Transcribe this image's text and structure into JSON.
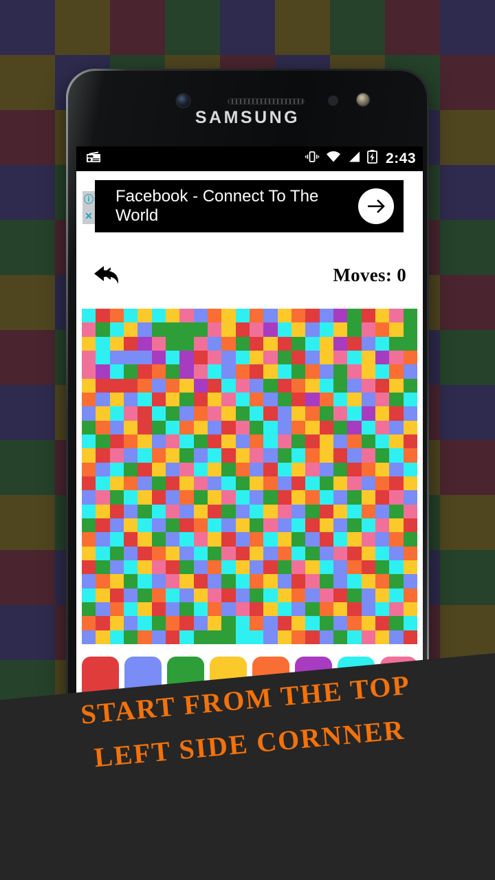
{
  "background": {
    "block_size": 80,
    "colors": [
      "#2e2b4e",
      "#4f4620",
      "#26422a",
      "#4a2530",
      "#2e2b4e",
      "#4f4620",
      "#26422a",
      "#4a2530"
    ],
    "grid": [
      [
        0,
        1,
        3,
        2,
        0,
        1,
        2,
        3,
        0
      ],
      [
        1,
        0,
        2,
        1,
        3,
        0,
        1,
        2,
        3
      ],
      [
        3,
        1,
        0,
        2,
        1,
        3,
        2,
        0,
        1
      ],
      [
        0,
        2,
        1,
        3,
        0,
        1,
        3,
        2,
        0
      ],
      [
        2,
        3,
        0,
        1,
        2,
        0,
        1,
        3,
        2
      ],
      [
        1,
        0,
        3,
        2,
        1,
        3,
        0,
        1,
        3
      ],
      [
        3,
        2,
        1,
        0,
        3,
        2,
        1,
        0,
        2
      ],
      [
        0,
        1,
        2,
        3,
        0,
        1,
        2,
        3,
        0
      ],
      [
        2,
        3,
        1,
        0,
        2,
        3,
        0,
        1,
        3
      ],
      [
        1,
        2,
        0,
        3,
        1,
        0,
        3,
        2,
        1
      ],
      [
        3,
        0,
        2,
        1,
        3,
        2,
        1,
        0,
        2
      ],
      [
        0,
        3,
        1,
        2,
        0,
        1,
        2,
        3,
        1
      ],
      [
        2,
        1,
        3,
        0,
        2,
        3,
        0,
        1,
        0
      ],
      [
        1,
        3,
        0,
        2,
        1,
        0,
        3,
        2,
        3
      ],
      [
        3,
        2,
        1,
        3,
        0,
        2,
        1,
        0,
        1
      ],
      [
        0,
        1,
        2,
        0,
        3,
        1,
        2,
        3,
        2
      ]
    ]
  },
  "phone": {
    "brand": "SAMSUNG",
    "camera_icon": "front-camera-icon",
    "speaker_icon": "earpiece-speaker-icon",
    "sensor_icon": "proximity-sensor-icon",
    "flash_icon": "iris-sensor-icon"
  },
  "statusbar": {
    "notification_icon": "radio-news-icon",
    "vibrate_icon": "vibrate-icon",
    "wifi_icon": "wifi-icon",
    "signal_icon": "cellular-signal-icon",
    "battery_icon": "battery-charging-icon",
    "time": "2:43"
  },
  "ad": {
    "headline": "Facebook - Connect To The World",
    "cta_icon": "arrow-right-icon",
    "adchoices_info_icon": "info-icon",
    "adchoices_close_icon": "close-icon"
  },
  "toolbar": {
    "undo_icon": "undo-arrow-icon",
    "moves_label": "Moves: 0"
  },
  "game": {
    "grid_size": 24,
    "palette_colors": [
      "#e03c3c",
      "#7a8cf5",
      "#2e9e38",
      "#fcc92a",
      "#f96e32",
      "#a83cc0",
      "#2ef0f0",
      "#f07099"
    ],
    "cell_colors": [
      "#2ef0f0",
      "#e03c3c",
      "#f96e32",
      "#f07099",
      "#2e9e38",
      "#fcc92a",
      "#7a8cf5",
      "#a83cc0"
    ],
    "cells": [
      [
        0,
        1,
        2,
        0,
        5,
        0,
        5,
        3,
        6,
        2,
        5,
        0,
        2,
        6,
        5,
        2,
        1,
        6,
        7,
        4,
        1,
        5,
        3,
        4
      ],
      [
        3,
        4,
        0,
        5,
        6,
        4,
        4,
        4,
        4,
        3,
        5,
        1,
        3,
        7,
        0,
        5,
        6,
        0,
        5,
        4,
        3,
        2,
        5,
        4
      ],
      [
        5,
        0,
        5,
        1,
        7,
        3,
        4,
        4,
        3,
        6,
        2,
        4,
        1,
        5,
        1,
        4,
        0,
        5,
        7,
        1,
        6,
        0,
        4,
        4
      ],
      [
        3,
        0,
        6,
        6,
        6,
        7,
        0,
        7,
        1,
        3,
        6,
        0,
        5,
        3,
        4,
        1,
        6,
        5,
        3,
        0,
        5,
        7,
        3,
        2
      ],
      [
        3,
        7,
        0,
        4,
        1,
        2,
        4,
        7,
        3,
        0,
        6,
        2,
        1,
        5,
        0,
        4,
        2,
        6,
        4,
        3,
        5,
        0,
        2,
        6
      ],
      [
        5,
        1,
        1,
        1,
        2,
        6,
        2,
        5,
        7,
        1,
        0,
        3,
        6,
        4,
        1,
        2,
        5,
        0,
        4,
        6,
        3,
        1,
        5,
        4
      ],
      [
        2,
        6,
        5,
        6,
        0,
        1,
        5,
        4,
        1,
        5,
        3,
        0,
        2,
        6,
        4,
        1,
        7,
        2,
        0,
        5,
        6,
        3,
        4,
        0
      ],
      [
        6,
        5,
        0,
        3,
        1,
        0,
        4,
        6,
        2,
        3,
        5,
        4,
        0,
        1,
        6,
        5,
        2,
        4,
        3,
        0,
        7,
        5,
        1,
        6
      ],
      [
        4,
        2,
        6,
        5,
        1,
        4,
        0,
        2,
        5,
        6,
        1,
        3,
        4,
        0,
        6,
        2,
        5,
        1,
        4,
        7,
        0,
        3,
        6,
        5
      ],
      [
        0,
        4,
        1,
        2,
        5,
        6,
        3,
        0,
        4,
        1,
        5,
        6,
        2,
        0,
        3,
        4,
        1,
        5,
        6,
        2,
        4,
        0,
        5,
        1
      ],
      [
        5,
        1,
        3,
        6,
        0,
        2,
        5,
        4,
        6,
        0,
        1,
        5,
        3,
        6,
        4,
        0,
        2,
        5,
        1,
        6,
        3,
        4,
        0,
        2
      ],
      [
        2,
        6,
        0,
        4,
        1,
        5,
        6,
        3,
        0,
        5,
        4,
        2,
        6,
        1,
        0,
        5,
        3,
        6,
        4,
        1,
        2,
        5,
        6,
        0
      ],
      [
        1,
        0,
        5,
        2,
        6,
        4,
        1,
        5,
        3,
        6,
        0,
        4,
        5,
        2,
        6,
        1,
        0,
        4,
        5,
        3,
        6,
        2,
        1,
        5
      ],
      [
        6,
        3,
        4,
        0,
        5,
        1,
        6,
        2,
        4,
        5,
        3,
        0,
        6,
        4,
        1,
        5,
        2,
        0,
        6,
        4,
        5,
        1,
        3,
        6
      ],
      [
        0,
        5,
        1,
        6,
        4,
        0,
        3,
        6,
        5,
        1,
        4,
        6,
        0,
        5,
        3,
        6,
        4,
        1,
        5,
        0,
        2,
        6,
        4,
        3
      ],
      [
        4,
        1,
        6,
        5,
        0,
        6,
        4,
        1,
        2,
        0,
        6,
        5,
        4,
        3,
        6,
        0,
        1,
        5,
        6,
        4,
        0,
        3,
        5,
        1
      ],
      [
        2,
        6,
        0,
        1,
        5,
        4,
        6,
        0,
        3,
        5,
        1,
        6,
        2,
        0,
        5,
        4,
        6,
        1,
        0,
        5,
        3,
        6,
        2,
        4
      ],
      [
        5,
        0,
        4,
        6,
        1,
        2,
        5,
        6,
        0,
        4,
        3,
        1,
        5,
        6,
        2,
        0,
        4,
        6,
        3,
        1,
        5,
        0,
        6,
        2
      ],
      [
        1,
        4,
        6,
        0,
        5,
        3,
        1,
        4,
        6,
        2,
        0,
        5,
        6,
        1,
        4,
        3,
        5,
        0,
        6,
        2,
        1,
        4,
        0,
        5
      ],
      [
        6,
        2,
        5,
        4,
        0,
        6,
        3,
        5,
        1,
        6,
        4,
        0,
        2,
        5,
        6,
        1,
        3,
        4,
        6,
        0,
        5,
        2,
        4,
        6
      ],
      [
        0,
        5,
        1,
        6,
        4,
        2,
        0,
        6,
        5,
        3,
        1,
        6,
        4,
        0,
        5,
        2,
        6,
        3,
        1,
        4,
        6,
        5,
        0,
        2
      ],
      [
        4,
        6,
        2,
        0,
        5,
        1,
        6,
        4,
        0,
        2,
        6,
        3,
        1,
        5,
        0,
        6,
        4,
        2,
        5,
        1,
        6,
        0,
        3,
        5
      ],
      [
        2,
        1,
        5,
        6,
        0,
        4,
        2,
        1,
        6,
        5,
        4,
        0,
        2,
        6,
        1,
        5,
        0,
        4,
        6,
        2,
        5,
        1,
        4,
        0
      ],
      [
        6,
        5,
        0,
        4,
        2,
        6,
        1,
        0,
        4,
        4,
        4,
        0,
        0,
        6,
        5,
        2,
        1,
        6,
        4,
        0,
        3,
        5,
        6,
        1
      ]
    ]
  },
  "caption": {
    "line1": "Start from the top",
    "line2": "left side cornner",
    "color": "#f2720c"
  }
}
